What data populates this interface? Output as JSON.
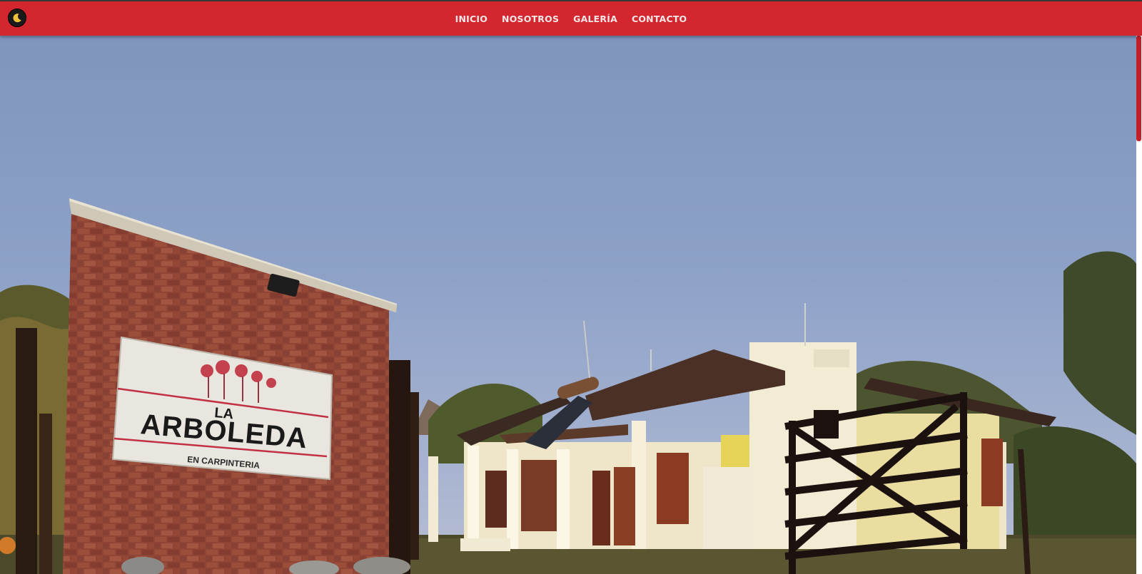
{
  "navbar": {
    "theme_toggle_icon": "moon-icon",
    "links": [
      "INICIO",
      "NOSOTROS",
      "GALERÍA",
      "CONTACTO"
    ],
    "background_color": "#d3262f"
  },
  "hero": {
    "sign": {
      "line1": "LA",
      "line2": "ARBOLEDA",
      "line3": "EN CARPINTERIA"
    }
  }
}
